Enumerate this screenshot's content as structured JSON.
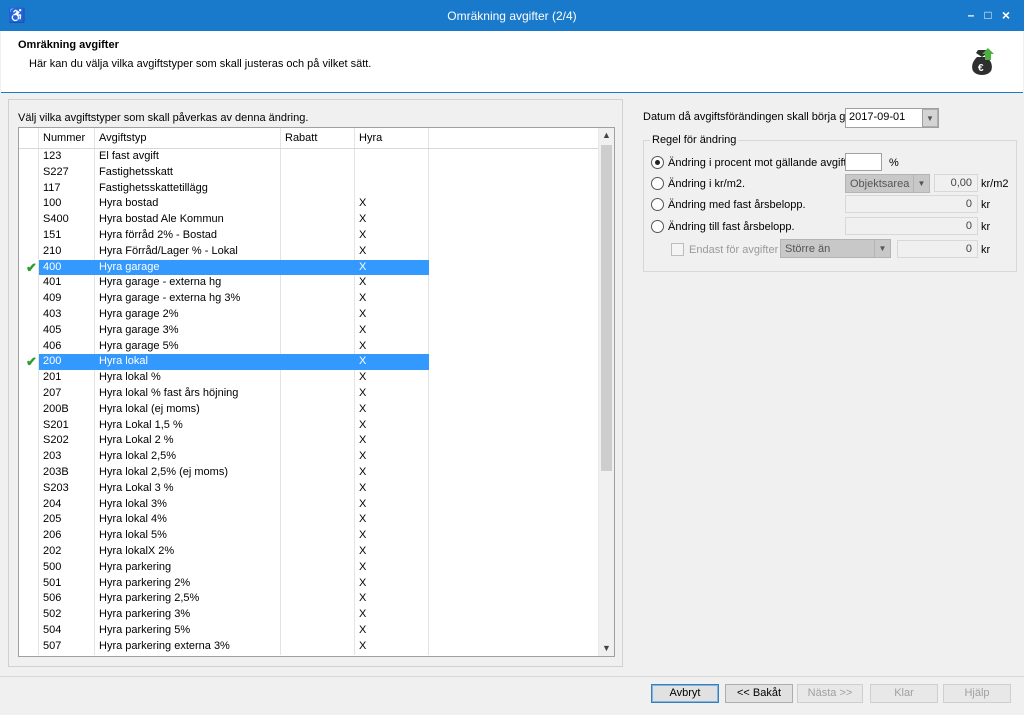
{
  "window": {
    "title": "Omräkning avgifter (2/4)",
    "app_icon": "wheelchair-icon",
    "minimize": "–",
    "maximize": "□",
    "close": "×"
  },
  "header": {
    "heading": "Omräkning avgifter",
    "description": "Här kan du välja vilka avgiftstyper som skall justeras och på vilket sätt.",
    "logo": "money-bag-icon"
  },
  "left": {
    "caption": "Välj vilka avgiftstyper som skall påverkas av denna ändring.",
    "columns": {
      "num": "Nummer",
      "typ": "Avgiftstyp",
      "rabatt": "Rabatt",
      "hyra": "Hyra"
    },
    "rows": [
      {
        "num": "123",
        "typ": "El  fast avgift",
        "rabatt": "",
        "hyra": "",
        "checked": false
      },
      {
        "num": "S227",
        "typ": "Fastighetsskatt",
        "rabatt": "",
        "hyra": "",
        "checked": false
      },
      {
        "num": "117",
        "typ": "Fastighetsskattetillägg",
        "rabatt": "",
        "hyra": "",
        "checked": false
      },
      {
        "num": "100",
        "typ": "Hyra bostad",
        "rabatt": "",
        "hyra": "X",
        "checked": false
      },
      {
        "num": "S400",
        "typ": "Hyra bostad Ale Kommun",
        "rabatt": "",
        "hyra": "X",
        "checked": false
      },
      {
        "num": "151",
        "typ": "Hyra förråd 2% - Bostad",
        "rabatt": "",
        "hyra": "X",
        "checked": false
      },
      {
        "num": "210",
        "typ": "Hyra Förråd/Lager % - Lokal",
        "rabatt": "",
        "hyra": "X",
        "checked": false
      },
      {
        "num": "400",
        "typ": "Hyra garage",
        "rabatt": "",
        "hyra": "X",
        "checked": true
      },
      {
        "num": "401",
        "typ": "Hyra garage - externa hg",
        "rabatt": "",
        "hyra": "X",
        "checked": false
      },
      {
        "num": "409",
        "typ": "Hyra garage - externa hg 3%",
        "rabatt": "",
        "hyra": "X",
        "checked": false
      },
      {
        "num": "403",
        "typ": "Hyra garage 2%",
        "rabatt": "",
        "hyra": "X",
        "checked": false
      },
      {
        "num": "405",
        "typ": "Hyra garage 3%",
        "rabatt": "",
        "hyra": "X",
        "checked": false
      },
      {
        "num": "406",
        "typ": "Hyra garage 5%",
        "rabatt": "",
        "hyra": "X",
        "checked": false
      },
      {
        "num": "200",
        "typ": "Hyra lokal",
        "rabatt": "",
        "hyra": "X",
        "checked": true
      },
      {
        "num": "201",
        "typ": "Hyra lokal %",
        "rabatt": "",
        "hyra": "X",
        "checked": false
      },
      {
        "num": "207",
        "typ": "Hyra lokal % fast års höjning",
        "rabatt": "",
        "hyra": "X",
        "checked": false
      },
      {
        "num": "200B",
        "typ": "Hyra lokal (ej moms)",
        "rabatt": "",
        "hyra": "X",
        "checked": false
      },
      {
        "num": "S201",
        "typ": "Hyra Lokal 1,5 %",
        "rabatt": "",
        "hyra": "X",
        "checked": false
      },
      {
        "num": "S202",
        "typ": "Hyra Lokal 2 %",
        "rabatt": "",
        "hyra": "X",
        "checked": false
      },
      {
        "num": "203",
        "typ": "Hyra lokal 2,5%",
        "rabatt": "",
        "hyra": "X",
        "checked": false
      },
      {
        "num": "203B",
        "typ": "Hyra lokal 2,5% (ej moms)",
        "rabatt": "",
        "hyra": "X",
        "checked": false
      },
      {
        "num": "S203",
        "typ": "Hyra Lokal 3 %",
        "rabatt": "",
        "hyra": "X",
        "checked": false
      },
      {
        "num": "204",
        "typ": "Hyra lokal 3%",
        "rabatt": "",
        "hyra": "X",
        "checked": false
      },
      {
        "num": "205",
        "typ": "Hyra lokal 4%",
        "rabatt": "",
        "hyra": "X",
        "checked": false
      },
      {
        "num": "206",
        "typ": "Hyra lokal 5%",
        "rabatt": "",
        "hyra": "X",
        "checked": false
      },
      {
        "num": "202",
        "typ": "Hyra lokalX 2%",
        "rabatt": "",
        "hyra": "X",
        "checked": false
      },
      {
        "num": "500",
        "typ": "Hyra parkering",
        "rabatt": "",
        "hyra": "X",
        "checked": false
      },
      {
        "num": "501",
        "typ": "Hyra parkering 2%",
        "rabatt": "",
        "hyra": "X",
        "checked": false
      },
      {
        "num": "506",
        "typ": "Hyra parkering 2,5%",
        "rabatt": "",
        "hyra": "X",
        "checked": false
      },
      {
        "num": "502",
        "typ": "Hyra parkering 3%",
        "rabatt": "",
        "hyra": "X",
        "checked": false
      },
      {
        "num": "504",
        "typ": "Hyra parkering 5%",
        "rabatt": "",
        "hyra": "X",
        "checked": false
      },
      {
        "num": "507",
        "typ": "Hyra parkering externa 3%",
        "rabatt": "",
        "hyra": "X",
        "checked": false
      }
    ]
  },
  "right": {
    "date_label": "Datum då avgiftsförändingen skall börja gälla",
    "date_value": "2017-09-01",
    "group_title": "Regel för ändring",
    "opt1": "Ändring i procent mot gällande avgift.",
    "opt1_value": "",
    "opt1_unit": "%",
    "opt2": "Ändring i kr/m2.",
    "opt2_combo": "Objektsarea",
    "opt2_value": "0,00",
    "opt2_unit": "kr/m2",
    "opt3": "Ändring med fast årsbelopp.",
    "opt3_value": "0",
    "opt3_unit": "kr",
    "opt4": "Ändring till fast årsbelopp.",
    "opt4_value": "0",
    "opt4_unit": "kr",
    "only_label": "Endast för avgifter",
    "only_combo": "Större än",
    "only_value": "0",
    "only_unit": "kr"
  },
  "footer": {
    "cancel": "Avbryt",
    "back": "<< Bakåt",
    "next": "Nästa >>",
    "done": "Klar",
    "help": "Hjälp"
  }
}
